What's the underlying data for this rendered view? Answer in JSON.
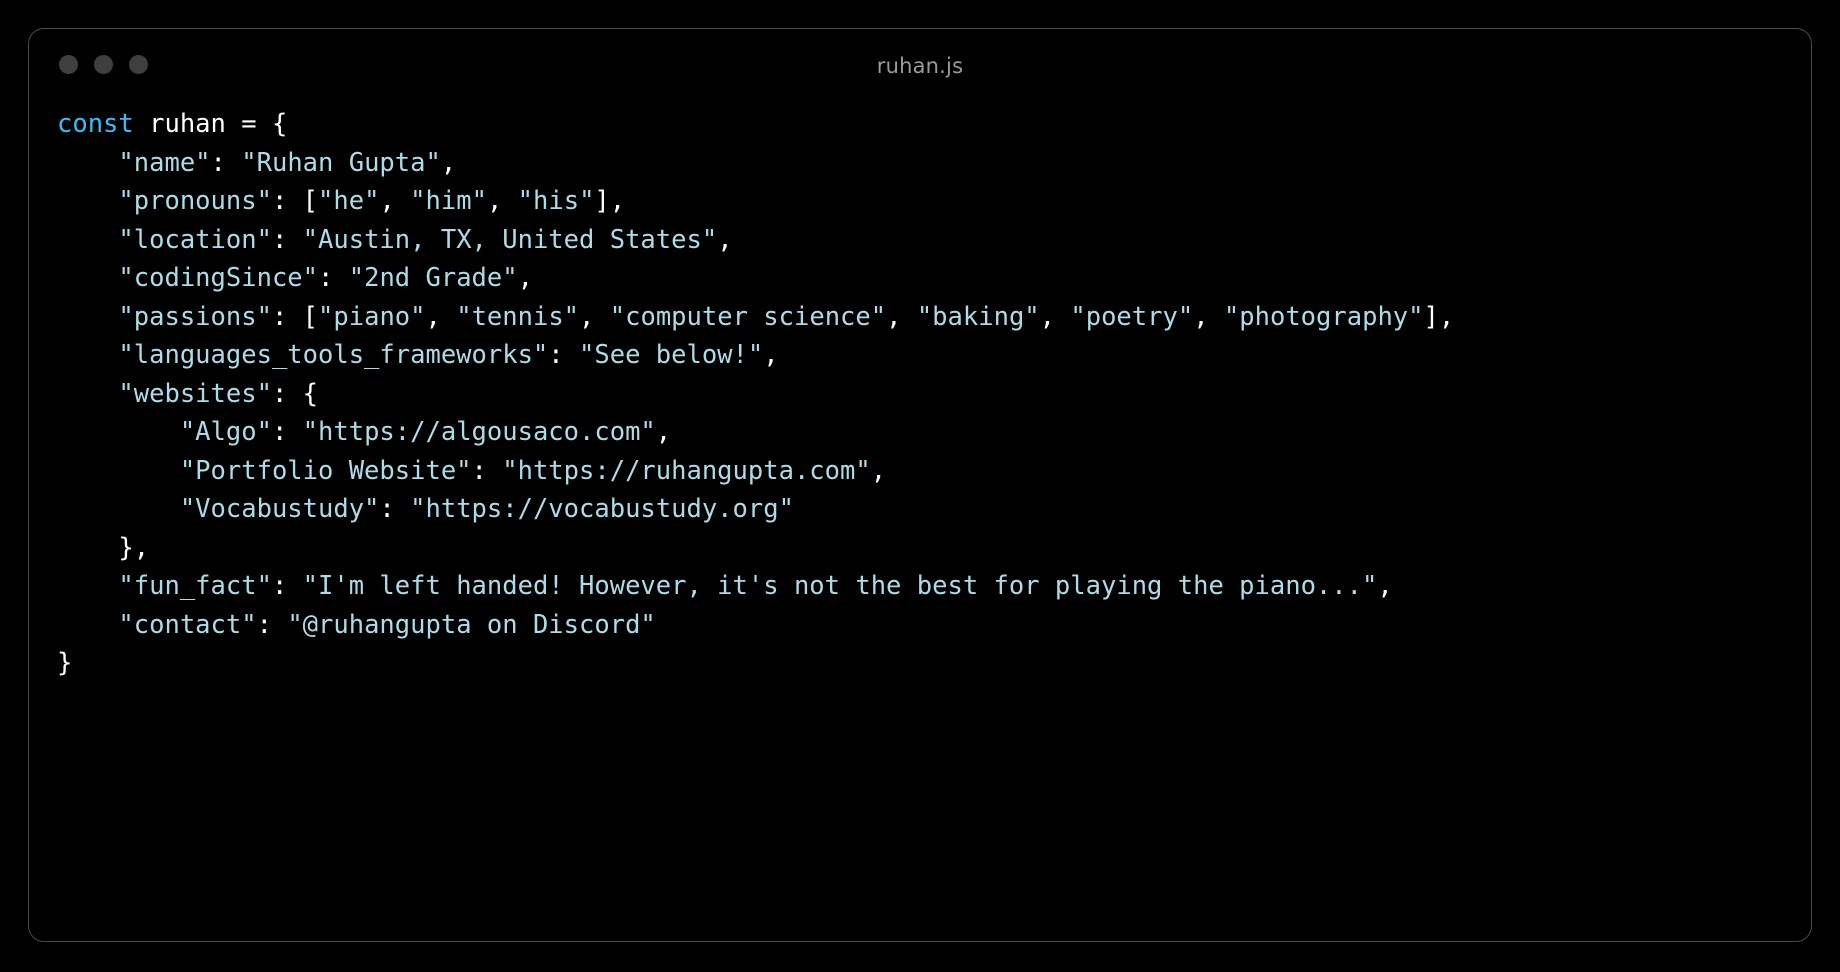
{
  "window": {
    "title": "ruhan.js",
    "traffic_lights": [
      "close-dot",
      "minimize-dot",
      "maximize-dot"
    ],
    "dot_color": "#3f3f3f",
    "border_color": "#4a4a4a",
    "background_color": "#000000",
    "title_color": "#9b9b9b"
  },
  "theme": {
    "keyword_color": "#38bdf8",
    "string_color": "#aedbe8",
    "punctuation_color": "#ffffff",
    "identifier_color": "#ffffff"
  },
  "code": {
    "declaration_keyword": "const",
    "variable_name": "ruhan",
    "assign": "=",
    "open_brace": "{",
    "close_brace": "}",
    "lines": {
      "l1": {
        "kw": "const",
        "id": " ruhan ",
        "pun": "= {"
      },
      "name": {
        "indent": "    ",
        "key": "\"name\"",
        "sep": ": ",
        "value": "\"Ruhan Gupta\"",
        "tail": ","
      },
      "pronouns": {
        "indent": "    ",
        "key": "\"pronouns\"",
        "sep": ": ",
        "open": "[",
        "v1": "\"he\"",
        "c1": ", ",
        "v2": "\"him\"",
        "c2": ", ",
        "v3": "\"his\"",
        "close": "],"
      },
      "location": {
        "indent": "    ",
        "key": "\"location\"",
        "sep": ": ",
        "value": "\"Austin, TX, United States\"",
        "tail": ","
      },
      "codingSince": {
        "indent": "    ",
        "key": "\"codingSince\"",
        "sep": ": ",
        "value": "\"2nd Grade\"",
        "tail": ","
      },
      "passions": {
        "indent": "    ",
        "key": "\"passions\"",
        "sep": ": ",
        "open": "[",
        "v1": "\"piano\"",
        "c1": ", ",
        "v2": "\"tennis\"",
        "c2": ", ",
        "v3": "\"computer science\"",
        "c3": ", ",
        "v4": "\"baking\"",
        "c4": ", ",
        "v5": "\"poetry\"",
        "c5": ", ",
        "v6": "\"photography\"",
        "close": "],"
      },
      "languages": {
        "indent": "    ",
        "key": "\"languages_tools_frameworks\"",
        "sep": ": ",
        "value": "\"See below!\"",
        "tail": ","
      },
      "websites_open": {
        "indent": "    ",
        "key": "\"websites\"",
        "sep": ": ",
        "open": "{"
      },
      "algo": {
        "indent": "        ",
        "key": "\"Algo\"",
        "sep": ": ",
        "value": "\"https://algousaco.com\"",
        "tail": ","
      },
      "portfolio": {
        "indent": "        ",
        "key": "\"Portfolio Website\"",
        "sep": ": ",
        "value": "\"https://ruhangupta.com\"",
        "tail": ","
      },
      "vocabustudy": {
        "indent": "        ",
        "key": "\"Vocabustudy\"",
        "sep": ": ",
        "value": "\"https://vocabustudy.org\"",
        "tail": ""
      },
      "websites_close": {
        "indent": "    ",
        "close": "},"
      },
      "fun_fact": {
        "indent": "    ",
        "key": "\"fun_fact\"",
        "sep": ": ",
        "value": "\"I'm left handed! However, it's not the best for playing the piano...\"",
        "tail": ","
      },
      "contact": {
        "indent": "    ",
        "key": "\"contact\"",
        "sep": ": ",
        "value": "\"@ruhangupta on Discord\"",
        "tail": ""
      },
      "end": {
        "close": "}"
      }
    }
  }
}
